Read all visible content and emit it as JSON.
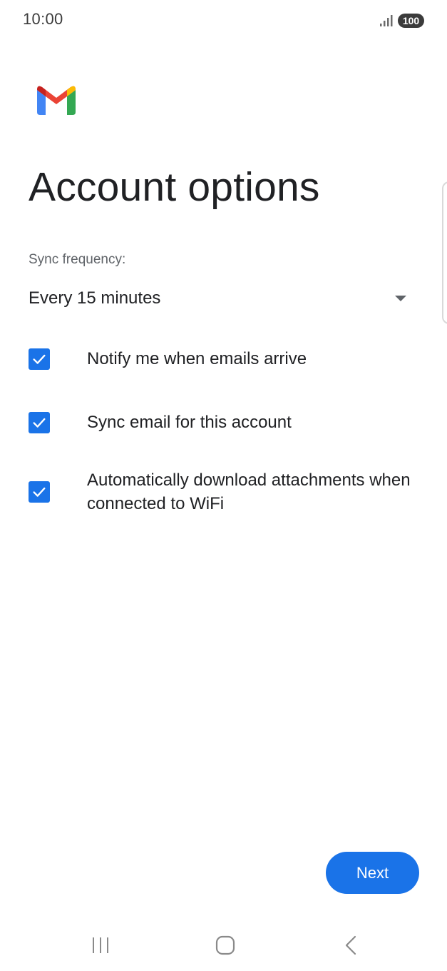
{
  "status_bar": {
    "time": "10:00",
    "battery": "100",
    "signal_icon": "signal-bars-icon"
  },
  "header": {
    "logo_icon": "gmail-logo-icon",
    "title": "Account options"
  },
  "sync": {
    "label": "Sync frequency:",
    "selected": "Every 15 minutes"
  },
  "options": [
    {
      "label": "Notify me when emails arrive",
      "checked": true
    },
    {
      "label": "Sync email for this account",
      "checked": true
    },
    {
      "label": "Automatically download attachments when connected to WiFi",
      "checked": true
    }
  ],
  "actions": {
    "next_label": "Next"
  },
  "nav": {
    "recents_icon": "recent-apps-icon",
    "home_icon": "home-icon",
    "back_icon": "back-icon"
  },
  "colors": {
    "accent": "#1a73e8",
    "text": "#202124",
    "secondary_text": "#5f6368",
    "gmail_red": "#ea4335",
    "gmail_blue": "#4285f4",
    "gmail_green": "#34a853",
    "gmail_yellow": "#fbbc04"
  }
}
